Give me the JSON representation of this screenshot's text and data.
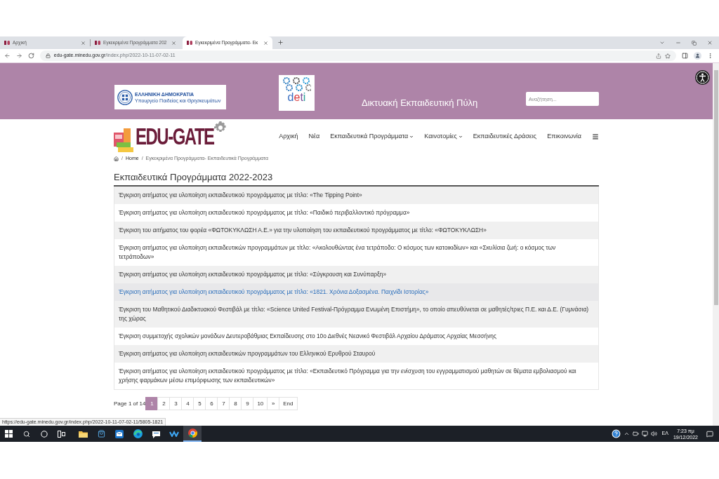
{
  "browser": {
    "tabs": [
      {
        "title": "Αρχική",
        "selected": false
      },
      {
        "title": "Εγκεκριμένα Προγράμματα 202",
        "selected": false
      },
      {
        "title": "Εγκεκριμένα Προγράμματα- Εκ",
        "selected": true
      }
    ],
    "address": {
      "host": "edu-gate.minedu.gov.gr",
      "path": "/index.php/2022-10-11-07-02-11"
    },
    "status_link": "https://edu-gate.minedu.gov.gr/index.php/2022-10-11-07-02-11/5805-1821"
  },
  "header": {
    "logo_card": {
      "line_1": "ΕΛΛΗΝΙΚΗ ΔΗΜΟΚΡΑΤΙΑ",
      "line_2": "Υπουργείο Παιδείας και Θρησκευμάτων"
    },
    "partner_logo": "deti",
    "portal_title": "Δικτυακή Εκπαιδευτική Πύλη",
    "search": {
      "placeholder": "Αναζήτηση..."
    }
  },
  "site_logo": "EDU-GATE",
  "nav": [
    {
      "label": "Αρχική",
      "dropdown": false
    },
    {
      "label": "Νέα",
      "dropdown": false
    },
    {
      "label": "Εκπαιδευτικά Προγράμματα",
      "dropdown": true
    },
    {
      "label": "Καινοτομίες",
      "dropdown": true
    },
    {
      "label": "Εκπαιδευτικές Δράσεις",
      "dropdown": false
    },
    {
      "label": "Επικοινωνία",
      "dropdown": false
    }
  ],
  "breadcrumb": [
    {
      "separator": "/",
      "label": "Home"
    },
    {
      "separator": "/",
      "label": "Εγκεκριμένα Προγράμματα- Εκπαιδευτικά Προγράμματα"
    }
  ],
  "heading": "Εκπαιδευτικά Προγράμματα 2022-2023",
  "programs": [
    {
      "title": "Έγκριση αιτήματος για υλοποίηση εκπαιδευτικού προγράμματος με τίτλο: «The Tipping Point»",
      "hovered": false
    },
    {
      "title": "Έγκριση αιτήματος για υλοποίηση εκπαιδευτικού προγράμματος με τίτλο: «Παιδικό περιβαλλοντικό πρόγραμμα»",
      "hovered": false
    },
    {
      "title": "Έγκριση του αιτήματος του φορέα «ΦΩΤΟΚΥΚΛΩΣΗ Α.Ε.» για την υλοποίηση του εκπαιδευτικού προγράμματος με τίτλο: «ΦΩΤΟΚΥΚΛΩΣΗ»",
      "hovered": false
    },
    {
      "title": "Έγκριση αιτήματος για υλοποίηση εκπαιδευτικών προγραμμάτων με τίτλο: «Ακολουθώντας ένα τετράποδο: Ο κόσμος των κατοικιδίων» και «Σκυλίσια ζωή: ο κόσμος των τετράποδων»",
      "hovered": false
    },
    {
      "title": "Έγκριση αιτήματος για υλοποίηση εκπαιδευτικού προγράμματος με τίτλο: «Σύγκρουση και Συνύπαρξη»",
      "hovered": false
    },
    {
      "title": "Έγκριση αιτήματος για υλοποίηση εκπαιδευτικού προγράμματος με τίτλο: «1821. Χρόνια Δοξασμένα. Παιχνίδι Ιστορίας»",
      "hovered": true
    },
    {
      "title": "Έγκριση του Μαθητικού Διαδικτυακού Φεστιβάλ με τίτλο: «Science United Festival-Πρόγραμμα Ενωμένη Επιστήμη», το οποίο απευθύνεται σε μαθητές/τριες Π.Ε. και Δ.Ε. (Γυμνάσια) της χώρας",
      "hovered": false
    },
    {
      "title": "Έγκριση συμμετοχής σχολικών μονάδων Δευτεροβάθμιας Εκπαίδευσης στο 10ο Διεθνές Νεανικό Φεστιβάλ Αρχαίου Δράματος Αρχαίας Μεσσήνης",
      "hovered": false
    },
    {
      "title": "Έγκριση αιτήματος για υλοποίηση εκπαιδευτικών προγραμμάτων του Ελληνικού Ερυθρού Σταυρού",
      "hovered": false
    },
    {
      "title": "Έγκριση αιτήματος για υλοποίηση εκπαιδευτικού προγράμματος με τίτλο: «Εκπαιδευτικό Πρόγραμμα για την ενίσχυση του εγγραμματισμού μαθητών σε θέματα εμβολιασμού και χρήσης φαρμάκων μέσω επιμόρφωσης των εκπαιδευτικών»",
      "hovered": false
    }
  ],
  "pagination": {
    "summary": "Page 1 of 14",
    "pages": [
      {
        "label": "1",
        "selected": true
      },
      {
        "label": "2",
        "selected": false
      },
      {
        "label": "3",
        "selected": false
      },
      {
        "label": "4",
        "selected": false
      },
      {
        "label": "5",
        "selected": false
      },
      {
        "label": "6",
        "selected": false
      },
      {
        "label": "7",
        "selected": false
      },
      {
        "label": "8",
        "selected": false
      },
      {
        "label": "9",
        "selected": false
      },
      {
        "label": "10",
        "selected": false
      },
      {
        "label": "»",
        "selected": false
      },
      {
        "label": "End",
        "selected": false
      }
    ]
  },
  "taskbar": {
    "language": "ΕΛ",
    "time": "7:23 πμ",
    "date": "19/12/2022"
  }
}
